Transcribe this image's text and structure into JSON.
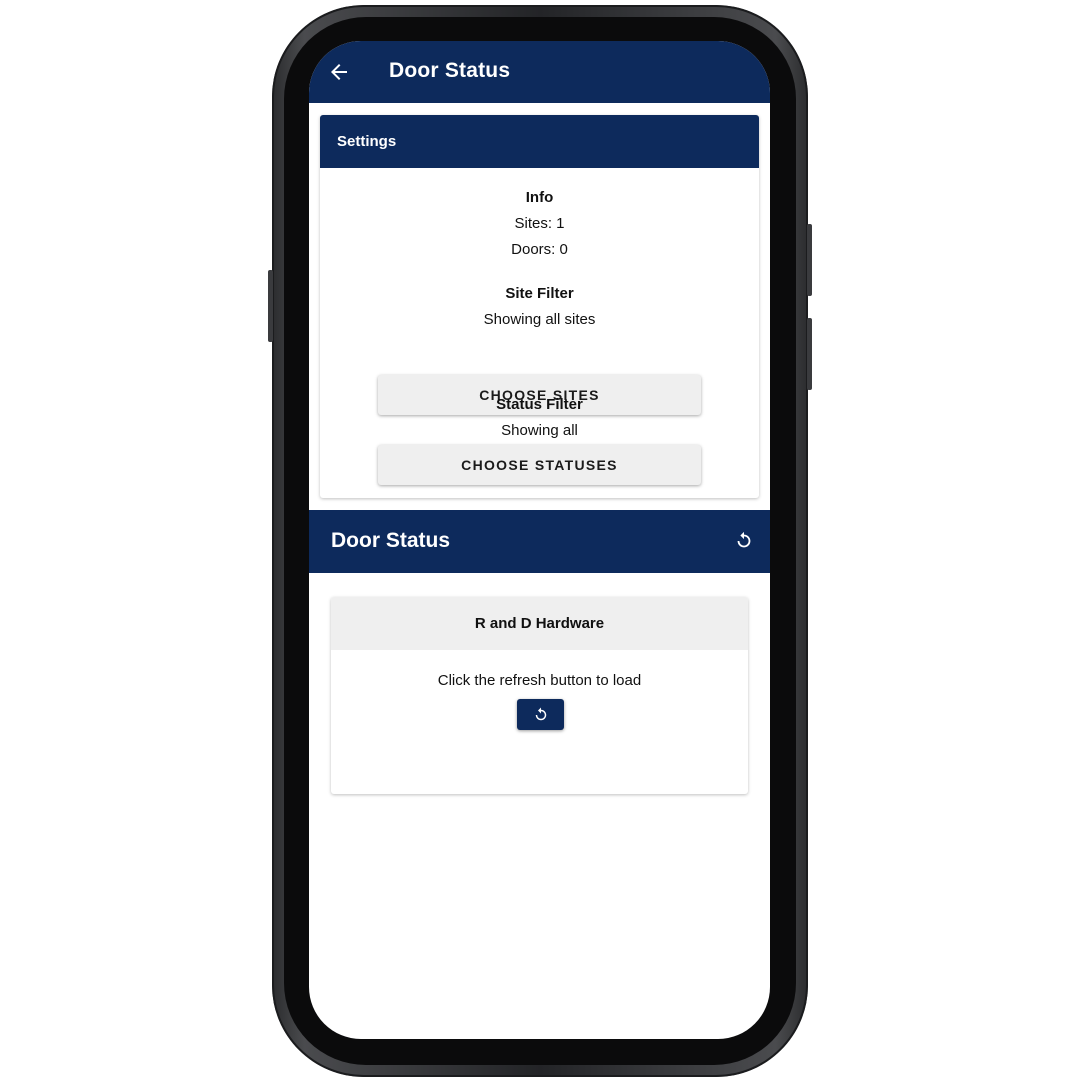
{
  "app": {
    "title": "Door Status",
    "colors": {
      "primary": "#0d2a5c",
      "card_header_light": "#efefef",
      "button_bg": "#efefef"
    },
    "icons": {
      "back": "arrow-left-icon",
      "refresh": "refresh-icon"
    }
  },
  "settings": {
    "header": "Settings",
    "info": {
      "heading": "Info",
      "sites": "Sites: 1",
      "doors": "Doors: 0"
    },
    "site_filter": {
      "heading": "Site Filter",
      "value": "Showing all sites",
      "button": "CHOOSE SITES"
    },
    "status_filter": {
      "heading": "Status Filter",
      "value": "Showing all",
      "button": "CHOOSE STATUSES"
    }
  },
  "door_status": {
    "title": "Door Status",
    "site_card": {
      "name": "R and D Hardware",
      "message": "Click the refresh button to load"
    }
  }
}
